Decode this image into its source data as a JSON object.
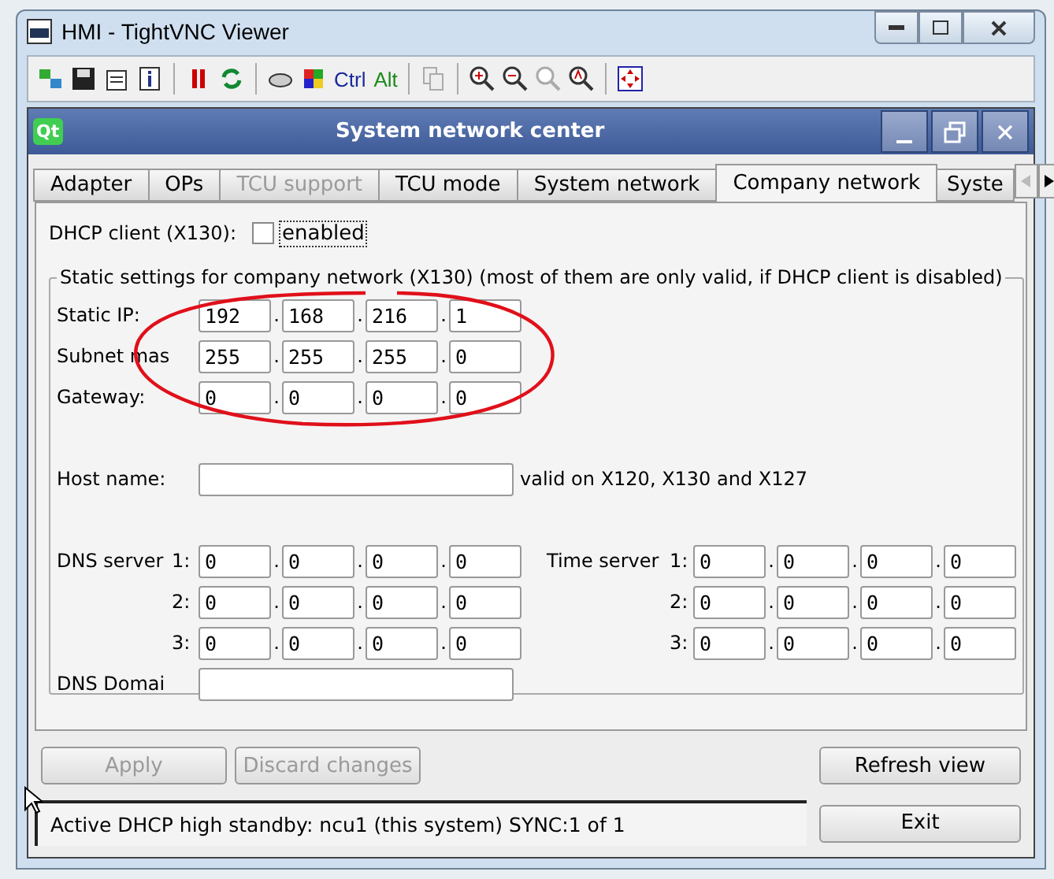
{
  "window": {
    "title": "HMI - TightVNC Viewer"
  },
  "toolbar": {
    "ctrl_key": "Ctrl",
    "alt_key": "Alt"
  },
  "dialog": {
    "logo": "Qt",
    "title": "System network center",
    "tabs": [
      {
        "label": "Adapter",
        "selected": false,
        "disabled": false
      },
      {
        "label": "OPs",
        "selected": false,
        "disabled": false
      },
      {
        "label": "TCU support",
        "selected": false,
        "disabled": true
      },
      {
        "label": "TCU mode",
        "selected": false,
        "disabled": false
      },
      {
        "label": "System network",
        "selected": false,
        "disabled": false
      },
      {
        "label": "Company network",
        "selected": true,
        "disabled": false
      },
      {
        "label": "Syste",
        "selected": false,
        "disabled": false
      }
    ],
    "dhcp": {
      "label": "DHCP client (X130):",
      "checkbox_label": "enabled",
      "checked": false
    },
    "static_group": {
      "title": "Static settings for company network (X130) (most of them are only valid, if DHCP client is disabled)",
      "rows": [
        {
          "label": "Static IP:",
          "octets": [
            "192",
            "168",
            "216",
            "1"
          ]
        },
        {
          "label": "Subnet mas",
          "octets": [
            "255",
            "255",
            "255",
            "0"
          ]
        },
        {
          "label": "Gateway:",
          "octets": [
            "0",
            "0",
            "0",
            "0"
          ]
        }
      ],
      "host_name": {
        "label": "Host name:",
        "note": "valid on X120, X130 and X127"
      },
      "dns": {
        "label": "DNS server",
        "rows": [
          {
            "index": "1:",
            "octets": [
              "0",
              "0",
              "0",
              "0"
            ]
          },
          {
            "index": "2:",
            "octets": [
              "0",
              "0",
              "0",
              "0"
            ]
          },
          {
            "index": "3:",
            "octets": [
              "0",
              "0",
              "0",
              "0"
            ]
          }
        ]
      },
      "time": {
        "label": "Time server",
        "rows": [
          {
            "index": "1:",
            "octets": [
              "0",
              "0",
              "0",
              "0"
            ]
          },
          {
            "index": "2:",
            "octets": [
              "0",
              "0",
              "0",
              "0"
            ]
          },
          {
            "index": "3:",
            "octets": [
              "0",
              "0",
              "0",
              "0"
            ]
          }
        ]
      },
      "dns_domain": {
        "label": "DNS Domai"
      },
      "separator": "."
    },
    "buttons": [
      {
        "label": "Apply",
        "disabled": true
      },
      {
        "label": "Discard changes",
        "disabled": true
      },
      {
        "label": "Refresh view",
        "disabled": false
      }
    ],
    "status": "Active DHCP high standby: ncu1 (this system) SYNC:1 of 1",
    "exit": "Exit"
  }
}
